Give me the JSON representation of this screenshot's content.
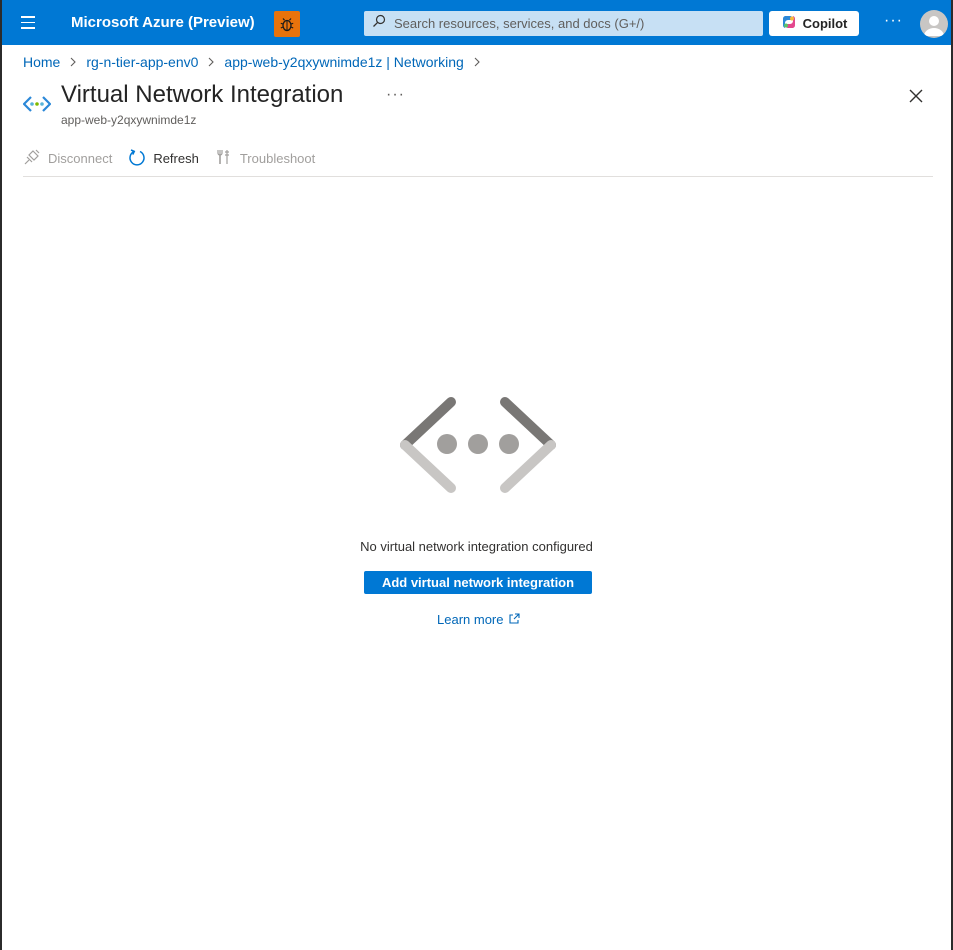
{
  "topbar": {
    "brand": "Microsoft Azure (Preview)",
    "search_placeholder": "Search resources, services, and docs (G+/)",
    "copilot_label": "Copilot",
    "more_label": "···"
  },
  "breadcrumb": {
    "items": [
      "Home",
      "rg-n-tier-app-env0",
      "app-web-y2qxywnimde1z | Networking"
    ]
  },
  "header": {
    "title": "Virtual Network Integration",
    "subtitle": "app-web-y2qxywnimde1z",
    "more_label": "···"
  },
  "toolbar": {
    "disconnect_label": "Disconnect",
    "refresh_label": "Refresh",
    "troubleshoot_label": "Troubleshoot"
  },
  "empty_state": {
    "message": "No virtual network integration configured",
    "add_button_label": "Add virtual network integration",
    "learn_more_label": "Learn more"
  },
  "colors": {
    "accent": "#0078d4",
    "link": "#0067b8",
    "bug_badge": "#e8730c",
    "disabled_text": "#a19f9d"
  },
  "icons": [
    "hamburger-icon",
    "bug-icon",
    "search-icon",
    "copilot-icon",
    "avatar-icon",
    "chevron-right-icon",
    "vnet-icon",
    "close-icon",
    "disconnect-icon",
    "refresh-icon",
    "troubleshoot-icon",
    "external-link-icon"
  ]
}
